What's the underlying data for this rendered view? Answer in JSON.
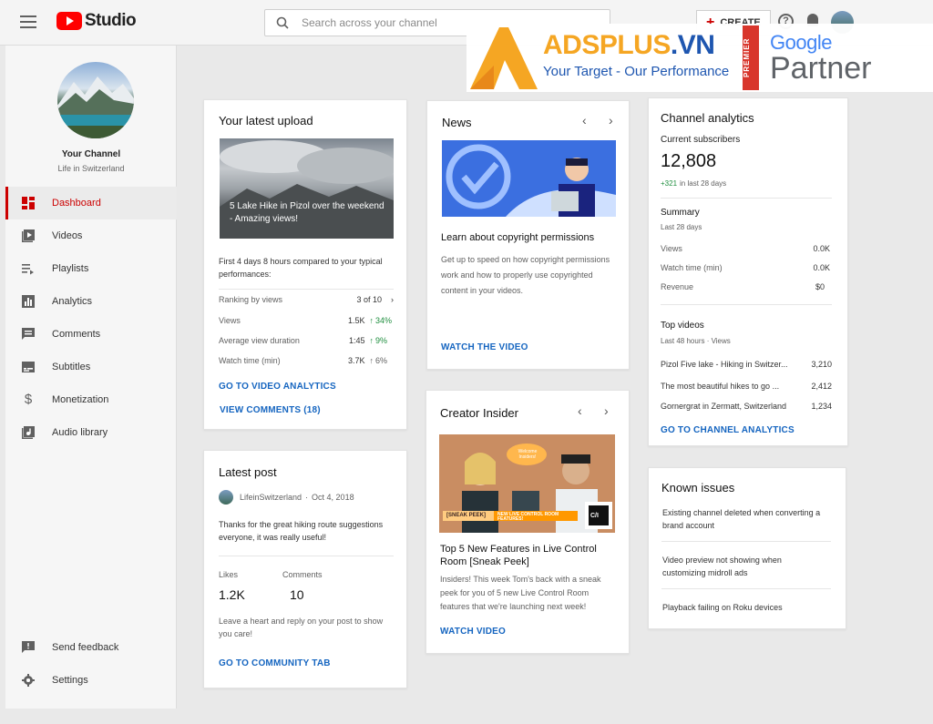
{
  "topbar": {
    "app_title": "Studio",
    "search_placeholder": "Search across your channel",
    "create_label": "CREATE"
  },
  "ad": {
    "brand_part1": "ADSPLUS",
    "brand_part2": ".VN",
    "tagline": "Your Target - Our Performance",
    "premier": "PREMIER",
    "google": "Google",
    "partner": "Partner"
  },
  "sidebar": {
    "channel_name": "Your Channel",
    "channel_sub": "Life in Switzerland",
    "items": [
      {
        "label": "Dashboard",
        "icon": "dashboard-icon",
        "active": true
      },
      {
        "label": "Videos",
        "icon": "videos-icon"
      },
      {
        "label": "Playlists",
        "icon": "playlists-icon"
      },
      {
        "label": "Analytics",
        "icon": "analytics-icon"
      },
      {
        "label": "Comments",
        "icon": "comments-icon"
      },
      {
        "label": "Subtitles",
        "icon": "subtitles-icon"
      },
      {
        "label": "Monetization",
        "icon": "monetization-icon"
      },
      {
        "label": "Audio library",
        "icon": "audio-library-icon"
      }
    ],
    "bottom_items": [
      {
        "label": "Send feedback",
        "icon": "feedback-icon"
      },
      {
        "label": "Settings",
        "icon": "settings-icon"
      }
    ]
  },
  "latest_upload": {
    "title": "Your latest upload",
    "video_title": "5 Lake Hike in Pizol over the weekend - Amazing views!",
    "comparison": "First 4 days 8 hours compared to your typical performances:",
    "ranking_label": "Ranking by views",
    "ranking_value": "3 of 10",
    "rows": [
      {
        "label": "Views",
        "value": "1.5K",
        "change": "34%",
        "up_green": true
      },
      {
        "label": "Average view duration",
        "value": "1:45",
        "change": "9%",
        "up_green": true
      },
      {
        "label": "Watch time (min)",
        "value": "3.7K",
        "change": "6%",
        "up_green": false
      }
    ],
    "analytics_link": "GO TO VIDEO ANALYTICS",
    "comments_link": "VIEW COMMENTS (18)"
  },
  "latest_post": {
    "title": "Latest post",
    "author": "LifeinSwitzerland",
    "date": "Oct 4, 2018",
    "text": "Thanks for the great hiking route suggestions everyone, it was really useful!",
    "likes_label": "Likes",
    "likes_value": "1.2K",
    "comments_label": "Comments",
    "comments_value": "10",
    "prompt": "Leave a heart and reply on your post to show you care!",
    "community_link": "GO TO COMMUNITY TAB"
  },
  "news": {
    "title": "News",
    "headline": "Learn about copyright permissions",
    "body": "Get up to speed on how copyright permissions work and how to properly use copyrighted content in your videos.",
    "link": "WATCH THE VIDEO"
  },
  "creator_insider": {
    "title": "Creator Insider",
    "video_title": "Top 5 New Features in Live Control Room [Sneak Peek]",
    "body": "Insiders!  This week Tom's back with a sneak peek for you of 5 new Live Control Room features that we're launching next week!",
    "link": "WATCH VIDEO",
    "thumb_bubble": "Welcome Insiders!",
    "thumb_banner": "[SNEAK PEEK]",
    "thumb_banner2": "NEW LIVE CONTROL ROOM FEATURES!",
    "thumb_badge": "C/I"
  },
  "channel_analytics": {
    "title": "Channel analytics",
    "subs_label": "Current subscribers",
    "subs_value": "12,808",
    "subs_change": "+321",
    "subs_period": "in last 28 days",
    "summary_title": "Summary",
    "summary_period": "Last 28 days",
    "summary_rows": [
      {
        "label": "Views",
        "value": "0.0K"
      },
      {
        "label": "Watch time (min)",
        "value": "0.0K"
      },
      {
        "label": "Revenue",
        "value": "$0"
      }
    ],
    "top_title": "Top videos",
    "top_period": "Last 48 hours · Views",
    "top_rows": [
      {
        "label": "Pizol Five lake - Hiking in Switzer...",
        "value": "3,210"
      },
      {
        "label": "The most beautiful hikes to go ...",
        "value": "2,412"
      },
      {
        "label": "Gornergrat in Zermatt, Switzerland",
        "value": "1,234"
      }
    ],
    "link": "GO TO CHANNEL ANALYTICS"
  },
  "known_issues": {
    "title": "Known issues",
    "items": [
      "Existing channel deleted when converting a brand account",
      "Video preview not showing when customizing midroll ads",
      "Playback failing on Roku devices"
    ]
  },
  "colors": {
    "accent_red": "#cc0000",
    "link_blue": "#1565c0",
    "positive_green": "#1e8e3e"
  }
}
